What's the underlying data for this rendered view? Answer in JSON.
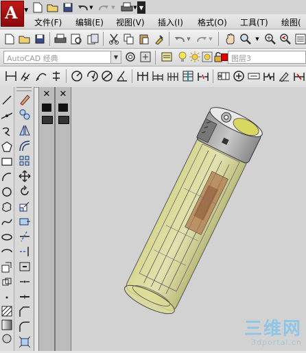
{
  "app": {
    "logo_letter": "A"
  },
  "menu": [
    "文件(F)",
    "编辑(E)",
    "视图(V)",
    "插入(I)",
    "格式(O)",
    "工具(T)",
    "绘图("
  ],
  "workspace": {
    "value": "AutoCAD 经典"
  },
  "layer": {
    "name": "图层3",
    "color": "#e00000"
  },
  "watermark": {
    "title": "三维网",
    "url": "3dportal.cn"
  },
  "icons": {
    "quick_access": [
      "new-icon",
      "open-icon",
      "save-icon",
      "undo-icon",
      "redo-icon",
      "plot-icon",
      "dropdown-icon"
    ],
    "standard": [
      "new-icon",
      "open-icon",
      "save-icon",
      "plot-icon",
      "plot-preview-icon",
      "publish-icon",
      "cut-icon",
      "copy-icon",
      "paste-icon",
      "match-properties-icon",
      "undo-icon",
      "redo-icon",
      "pan-icon",
      "zoom-icon"
    ],
    "dimension": [
      "linear-dim-icon",
      "aligned-dim-icon",
      "arc-length-icon",
      "ordinate-icon",
      "radius-icon",
      "jogged-icon",
      "diameter-icon",
      "angular-icon",
      "quick-dim-icon",
      "baseline-icon",
      "continue-icon",
      "spacing-icon",
      "break-icon",
      "tolerance-icon",
      "center-mark-icon",
      "inspect-icon",
      "jog-linear-icon",
      "edit-icon"
    ],
    "draw": [
      "line-icon",
      "construction-line-icon",
      "polyline-icon",
      "polygon-icon",
      "rectangle-icon",
      "arc-icon",
      "circle-icon",
      "revision-cloud-icon",
      "spline-icon",
      "ellipse-icon",
      "ellipse-arc-icon",
      "insert-block-icon",
      "make-block-icon",
      "point-icon",
      "hatch-icon",
      "gradient-icon",
      "region-icon",
      "table-icon"
    ],
    "modify": [
      "erase-icon",
      "copy-icon",
      "mirror-icon",
      "offset-icon",
      "array-icon",
      "move-icon",
      "rotate-icon",
      "scale-icon",
      "stretch-icon",
      "trim-icon",
      "extend-icon",
      "break-at-point-icon",
      "break-icon",
      "join-icon",
      "chamfer-icon",
      "fillet-icon",
      "explode-icon"
    ]
  },
  "colors": {
    "viewport_bg": "#d2d2d2",
    "lighter_body": "#c8c890",
    "layer_red": "#e00000"
  }
}
